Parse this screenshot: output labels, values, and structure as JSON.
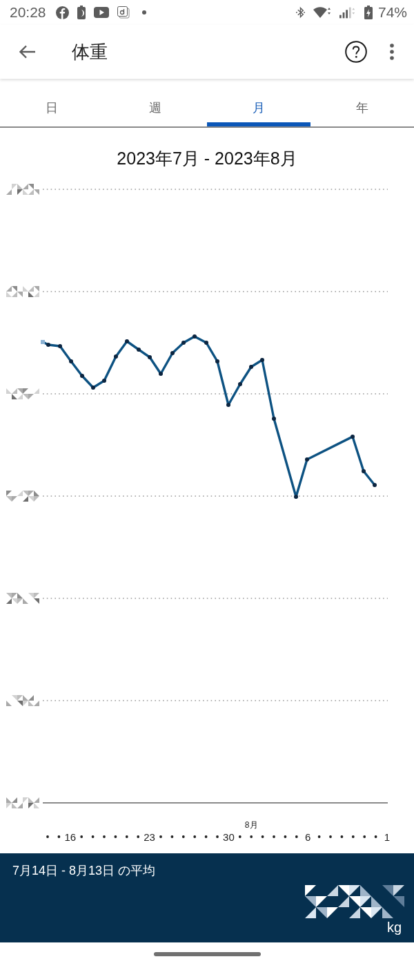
{
  "status_bar": {
    "time": "20:28",
    "battery": "74%"
  },
  "app_bar": {
    "title": "体重"
  },
  "tabs": [
    {
      "label": "日",
      "selected": false
    },
    {
      "label": "週",
      "selected": false
    },
    {
      "label": "月",
      "selected": true
    },
    {
      "label": "年",
      "selected": false
    }
  ],
  "chart": {
    "title": "2023年7月 - 2023年8月",
    "y_labels": [
      {
        "redacted": true
      },
      {
        "redacted": true
      },
      {
        "redacted": true
      },
      {
        "redacted": true
      },
      {
        "redacted": true
      },
      {
        "redacted": true
      },
      {
        "redacted": true
      }
    ],
    "x_ticks": [
      {
        "kind": "dot"
      },
      {
        "kind": "dot"
      },
      {
        "kind": "label",
        "text": "16"
      },
      {
        "kind": "dot"
      },
      {
        "kind": "dot"
      },
      {
        "kind": "dot"
      },
      {
        "kind": "dot"
      },
      {
        "kind": "dot"
      },
      {
        "kind": "dot"
      },
      {
        "kind": "label",
        "text": "23"
      },
      {
        "kind": "dot"
      },
      {
        "kind": "dot"
      },
      {
        "kind": "dot"
      },
      {
        "kind": "dot"
      },
      {
        "kind": "dot"
      },
      {
        "kind": "dot"
      },
      {
        "kind": "label",
        "text": "30"
      },
      {
        "kind": "dot"
      },
      {
        "kind": "dot",
        "month": "8月"
      },
      {
        "kind": "dot"
      },
      {
        "kind": "dot"
      },
      {
        "kind": "dot"
      },
      {
        "kind": "dot"
      },
      {
        "kind": "label",
        "text": "6"
      },
      {
        "kind": "dot"
      },
      {
        "kind": "dot"
      },
      {
        "kind": "dot"
      },
      {
        "kind": "dot"
      },
      {
        "kind": "dot"
      },
      {
        "kind": "dot"
      },
      {
        "kind": "label",
        "text": "1"
      }
    ]
  },
  "summary": {
    "label": "7月14日 - 8月13日 の平均",
    "value_redacted": true,
    "unit": "kg"
  }
}
